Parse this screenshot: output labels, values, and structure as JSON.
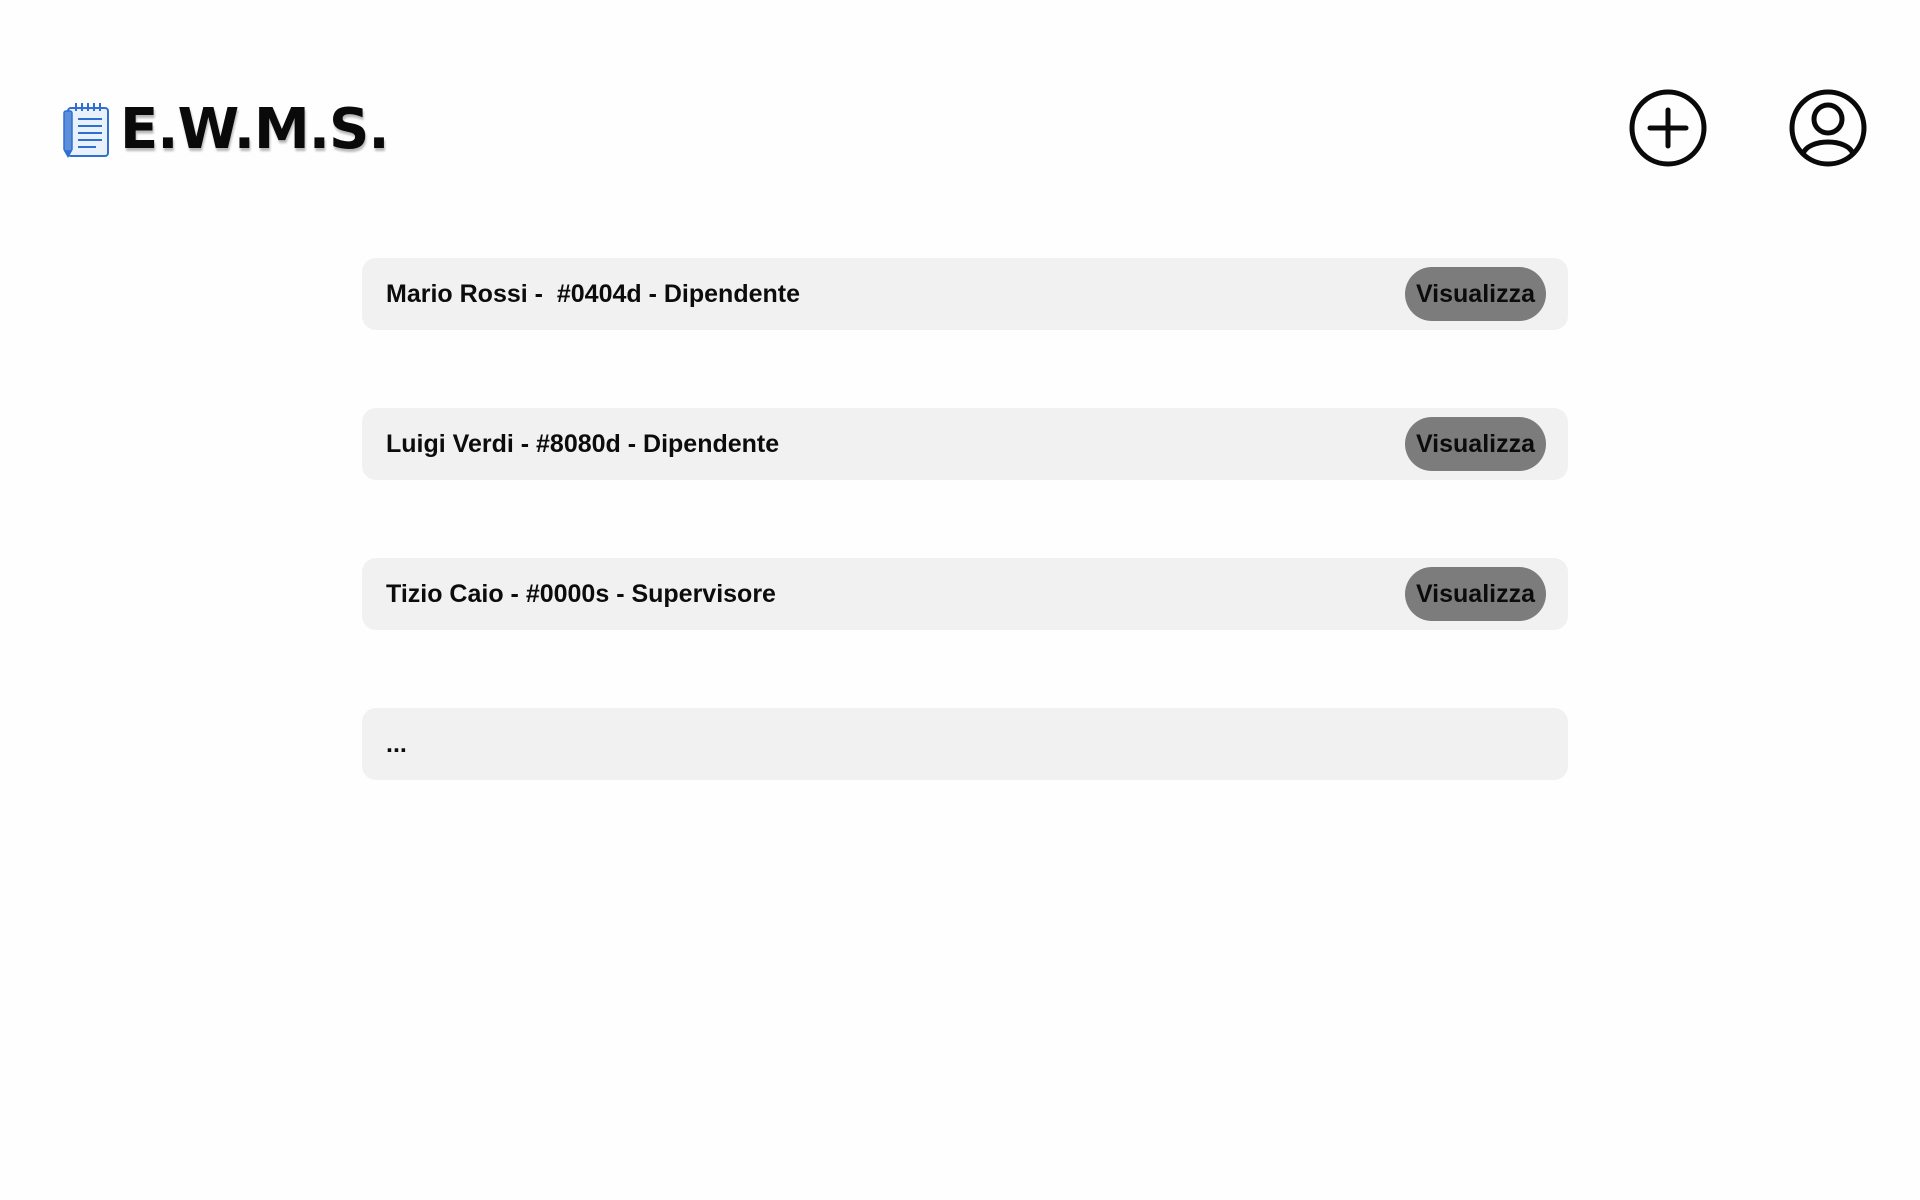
{
  "header": {
    "app_title": "E.W.M.S.",
    "logo_icon": "notepad-icon",
    "add_icon": "plus-circle-icon",
    "profile_icon": "user-circle-icon"
  },
  "employees": {
    "items": [
      {
        "label": "Mario Rossi -  #0404d - Dipendente",
        "action_label": "Visualizza"
      },
      {
        "label": "Luigi Verdi - #8080d - Dipendente",
        "action_label": "Visualizza"
      },
      {
        "label": "Tizio Caio - #0000s - Supervisore",
        "action_label": "Visualizza"
      },
      {
        "label": "..."
      }
    ]
  },
  "colors": {
    "background": "#fefefe",
    "row_background": "#f1f1f1",
    "button_background": "#7c7c7c",
    "logo_blue": "#2f6fd1"
  }
}
